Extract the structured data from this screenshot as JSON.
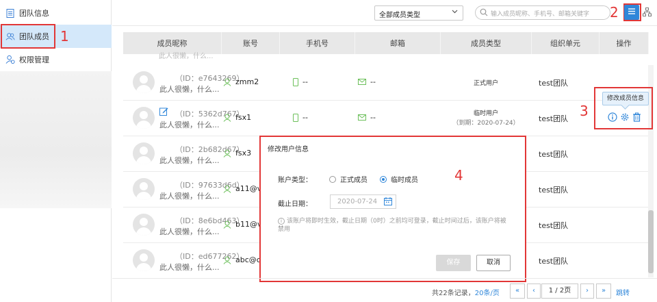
{
  "sidebar": {
    "items": [
      {
        "label": "团队信息",
        "icon": "document-icon"
      },
      {
        "label": "团队成员",
        "icon": "users-icon",
        "active": true
      },
      {
        "label": "权限管理",
        "icon": "user-settings-icon"
      }
    ]
  },
  "annotations": {
    "n1": "1",
    "n2": "2",
    "n3": "3",
    "n4": "4"
  },
  "toolbar": {
    "member_type_select": "全部成员类型",
    "search_placeholder": "输入成员昵称、手机号、邮箱关键字"
  },
  "table": {
    "columns": [
      "成员昵称",
      "账号",
      "手机号",
      "邮箱",
      "成员类型",
      "组织单元",
      "操作"
    ],
    "header_ghost": "此人很懒，什么...",
    "rows": [
      {
        "id": "（ID：e7643269）",
        "desc": "此人很懒，什么...",
        "account": "zmm2",
        "phone": "--",
        "email": "--",
        "type": "正式用户",
        "org": "test团队"
      },
      {
        "id": "（ID：5362d767）",
        "desc": "此人很懒，什么...",
        "account": "fsx1",
        "phone": "--",
        "email": "--",
        "type": "临时用户",
        "type_expire": "（到期：2020-07-24）",
        "org": "test团队"
      },
      {
        "id": "（ID：2b682d67）",
        "desc": "此人很懒，什么...",
        "account": "fsx3",
        "org": "test团队"
      },
      {
        "id": "（ID：97633d6d）",
        "desc": "此人很懒，什么...",
        "account": "a11@v",
        "org": "test团队"
      },
      {
        "id": "（ID：8e6bd463）",
        "desc": "此人很懒，什么...",
        "account": "b11@v",
        "org": "test团队"
      },
      {
        "id": "（ID：ed677262）",
        "desc": "此人很懒，什么...",
        "account": "abc@c",
        "org": "test团队"
      }
    ]
  },
  "tooltip": "修改成员信息",
  "modal": {
    "title": "修改用户信息",
    "account_type_label": "账户类型：",
    "option_formal": "正式成员",
    "option_temp": "临时成员",
    "selected": "临时成员",
    "date_label": "截止日期：",
    "date_value": "2020-07-24",
    "hint": "该账户将即时生效，截止日期（0时）之前均可登录，截止时间过后，该账户将被禁用",
    "save": "保存",
    "cancel": "取消"
  },
  "pagination": {
    "total": "共22条记录，",
    "per_page": "20条/页",
    "first": "«",
    "prev": "‹",
    "page_info": "1 / 2页",
    "next": "›",
    "last": "»",
    "jump": "跳转"
  },
  "colors": {
    "accent": "#2f86d9",
    "annotation": "#e23636",
    "active_bg": "#d4e8fa",
    "green": "#6bbf59"
  }
}
